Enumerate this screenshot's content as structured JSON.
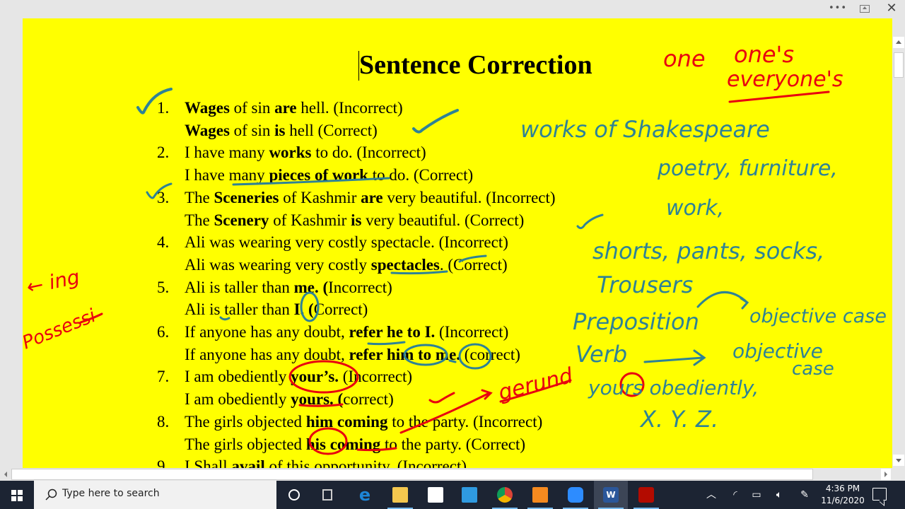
{
  "window": {
    "controls": {
      "more": "•••",
      "restore": "",
      "close": "✕"
    }
  },
  "document": {
    "title": "Sentence Correction",
    "items": [
      {
        "num": "1.",
        "incorrect": [
          {
            "t": "Wages",
            "b": true
          },
          {
            "t": " of sin "
          },
          {
            "t": "are",
            "b": true
          },
          {
            "t": " hell. (Incorrect)"
          }
        ],
        "correct": [
          {
            "t": "Wages",
            "b": true
          },
          {
            "t": " of sin "
          },
          {
            "t": "is",
            "b": true
          },
          {
            "t": " hell (Correct)"
          }
        ]
      },
      {
        "num": "2.",
        "incorrect": [
          {
            "t": "I have many "
          },
          {
            "t": "works",
            "b": true
          },
          {
            "t": " to do. (Incorrect)"
          }
        ],
        "correct": [
          {
            "t": "I have many "
          },
          {
            "t": "pieces of work",
            "b": true
          },
          {
            "t": " to do. (Correct)"
          }
        ]
      },
      {
        "num": "3.",
        "incorrect": [
          {
            "t": "The "
          },
          {
            "t": "Sceneries",
            "b": true
          },
          {
            "t": " of Kashmir "
          },
          {
            "t": "are",
            "b": true
          },
          {
            "t": " very beautiful. (Incorrect)"
          }
        ],
        "correct": [
          {
            "t": "The "
          },
          {
            "t": "Scenery",
            "b": true
          },
          {
            "t": " of Kashmir "
          },
          {
            "t": "is",
            "b": true
          },
          {
            "t": " very beautiful. (Correct)"
          }
        ]
      },
      {
        "num": "4.",
        "incorrect": [
          {
            "t": "Ali was wearing very costly spectacle. (Incorrect)"
          }
        ],
        "correct": [
          {
            "t": "Ali was wearing very costly "
          },
          {
            "t": "spectacles",
            "b": true
          },
          {
            "t": ". (Correct)"
          }
        ]
      },
      {
        "num": "5.",
        "incorrect": [
          {
            "t": "Ali is taller than "
          },
          {
            "t": "me. (",
            "b": true
          },
          {
            "t": "Incorrect)"
          }
        ],
        "correct": [
          {
            "t": "Ali is taller than "
          },
          {
            "t": "I. (",
            "b": true
          },
          {
            "t": "Correct)"
          }
        ]
      },
      {
        "num": "6.",
        "incorrect": [
          {
            "t": "If anyone has any doubt, "
          },
          {
            "t": "refer he to I.",
            "b": true
          },
          {
            "t": " (Incorrect)"
          }
        ],
        "correct": [
          {
            "t": "If anyone has any doubt, "
          },
          {
            "t": "refer him to me.",
            "b": true
          },
          {
            "t": " (correct)"
          }
        ]
      },
      {
        "num": "7.",
        "incorrect": [
          {
            "t": "I am obediently "
          },
          {
            "t": "your’s.",
            "b": true
          },
          {
            "t": " (Incorrect)"
          }
        ],
        "correct": [
          {
            "t": "I am obediently "
          },
          {
            "t": "yours. (",
            "b": true
          },
          {
            "t": "correct)"
          }
        ]
      },
      {
        "num": "8.",
        "incorrect": [
          {
            "t": "The girls objected "
          },
          {
            "t": "him coming",
            "b": true
          },
          {
            "t": " to the party. (Incorrect)"
          }
        ],
        "correct": [
          {
            "t": "The girls objected "
          },
          {
            "t": "his coming",
            "b": true
          },
          {
            "t": " to the party.  (Correct)"
          }
        ]
      },
      {
        "num": "9.",
        "incorrect": [
          {
            "t": "I Shall "
          },
          {
            "t": "avail",
            "b": true
          },
          {
            "t": " of this opportunity. (Incorrect)"
          }
        ]
      }
    ]
  },
  "annotations": {
    "teal": [
      "works of Shakespeare",
      "poetry, furniture,",
      "work,",
      "shorts, pants, socks,",
      "Trousers",
      "Preposition",
      "objective case",
      "Verb",
      "objective",
      "case",
      "yours obediently,",
      "X. Y. Z."
    ],
    "red": [
      "one",
      "one's",
      "everyone's",
      "← ing",
      "Possessi",
      "gerund"
    ],
    "colors": {
      "teal": "#2e8296",
      "red": "#e8000f",
      "page": "#ffff00"
    }
  },
  "taskbar": {
    "search_placeholder": "Type here to search",
    "apps": [
      "cortana",
      "task-view",
      "edge",
      "file-explorer",
      "store",
      "mail",
      "chrome",
      "foxit-pdf",
      "zoom",
      "word",
      "acrobat"
    ],
    "time": "4:36 PM",
    "date": "11/6/2020"
  }
}
